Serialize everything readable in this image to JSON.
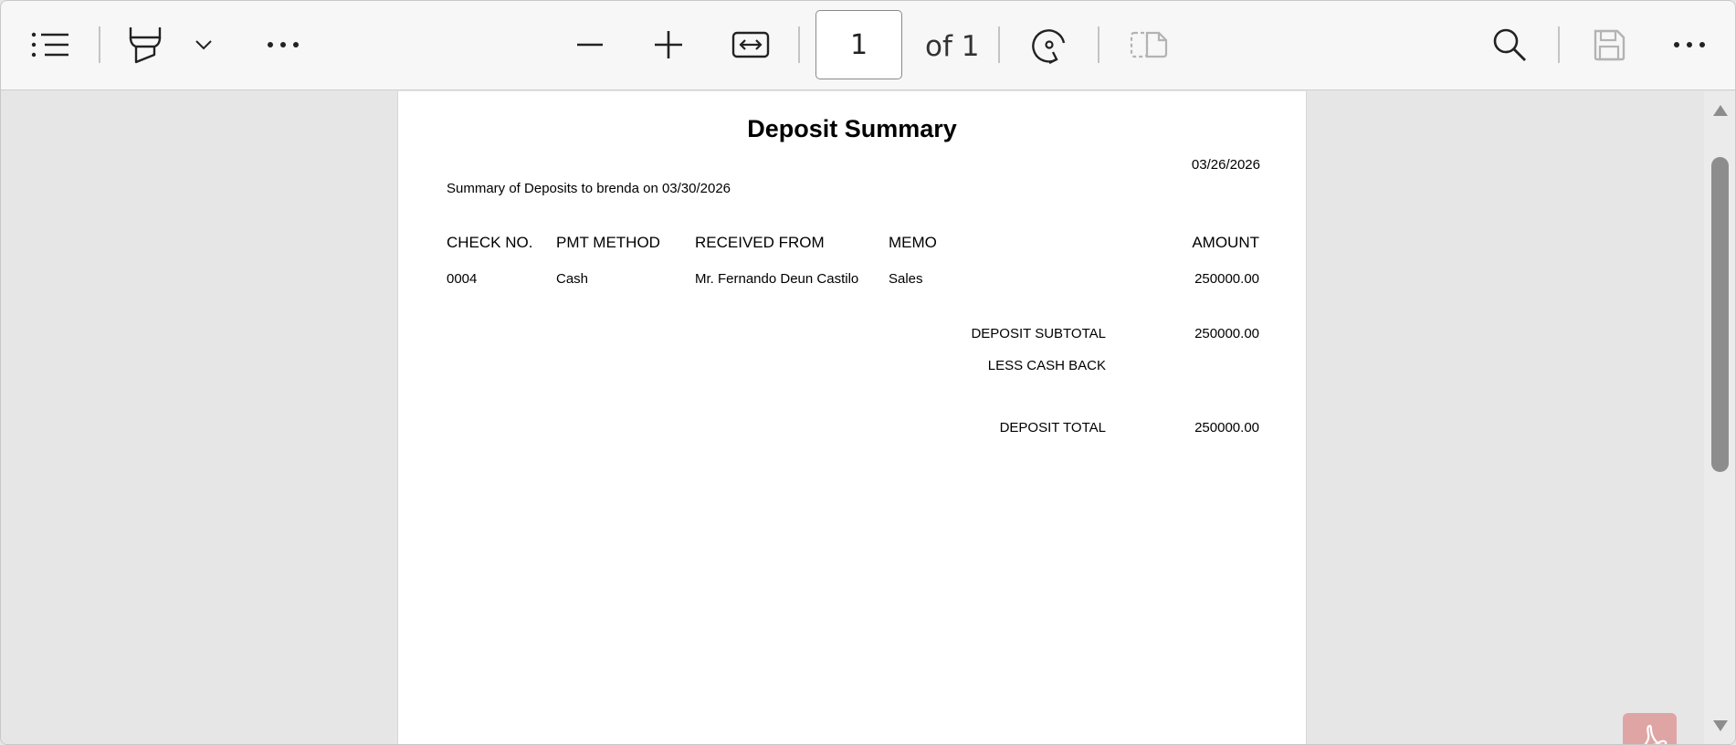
{
  "toolbar": {
    "page_number": "1",
    "page_of": "of 1",
    "icons": [
      "contents-icon",
      "highlight-icon",
      "chevron-down-icon",
      "more-icon",
      "zoom-out-icon",
      "zoom-in-icon",
      "fit-width-icon",
      "rotate-icon",
      "page-view-icon",
      "search-icon",
      "save-icon",
      "more-icon"
    ]
  },
  "document": {
    "title": "Deposit Summary",
    "date": "03/26/2026",
    "subtitle": "Summary of Deposits to brenda on 03/30/2026",
    "columns": {
      "check_no": "CHECK NO.",
      "pmt_method": "PMT METHOD",
      "received_from": "RECEIVED FROM",
      "memo": "MEMO",
      "amount": "AMOUNT"
    },
    "rows": [
      {
        "check_no": "0004",
        "pmt_method": "Cash",
        "received_from": "Mr. Fernando Deun Castilo",
        "memo": "Sales",
        "amount": "250000.00"
      }
    ],
    "summary": {
      "subtotal_label": "DEPOSIT SUBTOTAL",
      "subtotal_value": "250000.00",
      "cashback_label": "LESS CASH BACK",
      "cashback_value": "",
      "total_label": "DEPOSIT TOTAL",
      "total_value": "250000.00"
    }
  },
  "colors": {
    "toolbar_bg": "#f7f7f7",
    "viewer_bg": "#e6e6e6",
    "paper_bg": "#ffffff",
    "adobe_badge": "#dfa5a5"
  }
}
